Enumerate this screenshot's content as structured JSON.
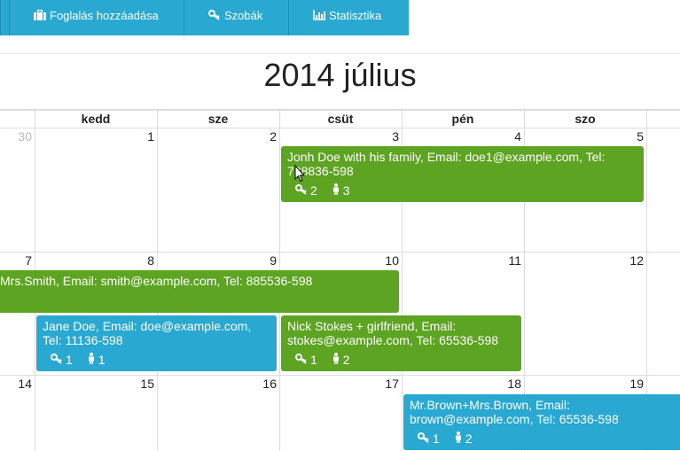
{
  "nav": [
    {
      "label": "Foglalás hozzáadása",
      "icon": "briefcase-icon"
    },
    {
      "label": "Szobák",
      "icon": "key-icon"
    },
    {
      "label": "Statisztika",
      "icon": "bar-chart-icon"
    }
  ],
  "calendar": {
    "title": "2014 július",
    "days": [
      "kedd",
      "sze",
      "csüt",
      "pén",
      "szo"
    ],
    "weeks": [
      [
        "30",
        "1",
        "2",
        "3",
        "4",
        "5"
      ],
      [
        "7",
        "8",
        "9",
        "10",
        "11",
        "12"
      ],
      [
        "14",
        "15",
        "16",
        "17",
        "18",
        "19"
      ]
    ]
  },
  "events": [
    {
      "text": "Jonh Doe with his family, Email: doe1@example.com, Tel: 788836-598",
      "rooms": "2",
      "people": "3",
      "color": "#5da423"
    },
    {
      "text": "Mrs.Smith, Email: smith@example.com, Tel: 885536-598",
      "color": "#5da423"
    },
    {
      "text": "Jane Doe, Email: doe@example.com, Tel: 11136-598",
      "rooms": "1",
      "people": "1",
      "color": "#29a9d2"
    },
    {
      "text": "Nick Stokes + girlfriend, Email: stokes@example.com, Tel: 65536-598",
      "rooms": "1",
      "people": "2",
      "color": "#5da423"
    },
    {
      "text": "Mr.Brown+Mrs.Brown, Email: brown@example.com, Tel: 65536-598",
      "rooms": "1",
      "people": "2",
      "color": "#29a9d2"
    }
  ]
}
